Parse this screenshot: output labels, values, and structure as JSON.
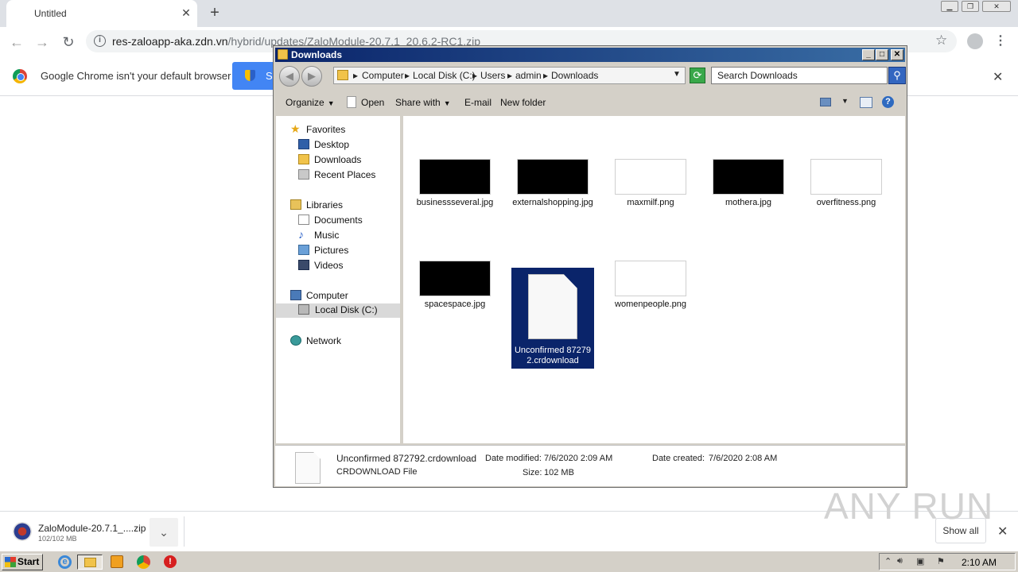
{
  "browser": {
    "tab_title": "Untitled",
    "url_host": "res-zaloapp-aka.zdn.vn",
    "url_path": "/hybrid/updates/ZaloModule-20.7.1_20.6.2-RC1.zip",
    "infobar_text": "Google Chrome isn't your default browser",
    "default_button_label": "S"
  },
  "explorer": {
    "title": "Downloads",
    "breadcrumbs": [
      "Computer",
      "Local Disk (C:)",
      "Users",
      "admin",
      "Downloads"
    ],
    "search_placeholder": "Search Downloads",
    "commands": {
      "organize": "Organize",
      "open": "Open",
      "share_with": "Share with",
      "email": "E-mail",
      "new_folder": "New folder"
    },
    "nav": {
      "favorites": "Favorites",
      "desktop": "Desktop",
      "downloads": "Downloads",
      "recent_places": "Recent Places",
      "libraries": "Libraries",
      "documents": "Documents",
      "music": "Music",
      "pictures": "Pictures",
      "videos": "Videos",
      "computer": "Computer",
      "local_disk": "Local Disk (C:)",
      "network": "Network"
    },
    "files": [
      {
        "name": "businessseveral.jpg",
        "thumb": "black"
      },
      {
        "name": "externalshopping.jpg",
        "thumb": "black"
      },
      {
        "name": "maxmilf.png",
        "thumb": "white"
      },
      {
        "name": "mothera.jpg",
        "thumb": "black"
      },
      {
        "name": "overfitness.png",
        "thumb": "white"
      },
      {
        "name": "spacespace.jpg",
        "thumb": "black"
      },
      {
        "name": "Unconfirmed 872792.crdownload",
        "thumb": "document",
        "selected": true
      },
      {
        "name": "womenpeople.png",
        "thumb": "white"
      }
    ],
    "details": {
      "name": "Unconfirmed 872792.crdownload",
      "type": "CRDOWNLOAD File",
      "modified_label": "Date modified:",
      "modified_value": "7/6/2020 2:09 AM",
      "created_label": "Date created:",
      "created_value": "7/6/2020 2:08 AM",
      "size_label": "Size:",
      "size_value": "102 MB"
    }
  },
  "downloads_shelf": {
    "file_name": "ZaloModule-20.7.1_....zip",
    "progress": "102/102 MB",
    "show_all": "Show all"
  },
  "taskbar": {
    "start_label": "Start",
    "clock": "2:10 AM"
  },
  "watermark": "ANY RUN",
  "colors": {
    "titlebar": "#0a246a",
    "selection": "#0a246a",
    "chrome_blue": "#4285f4"
  }
}
